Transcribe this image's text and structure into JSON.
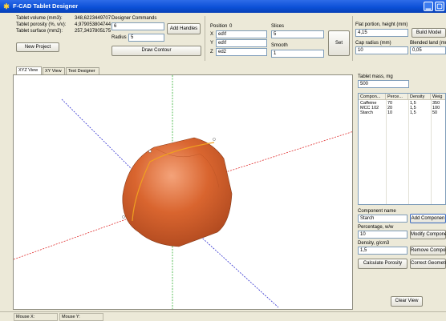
{
  "window": {
    "title": "F-CAD Tablet Designer",
    "icon": "app-logo-icon",
    "controls": [
      "minimize-icon",
      "maximize-icon"
    ]
  },
  "stats": {
    "volume_label": "Tablet volume (mm3):",
    "volume_value": "348,6223449707",
    "porosity_label": "Tablet porosity (%, v/v):",
    "porosity_value": "4,979053804744",
    "surface_label": "Tablet surface (mm2):",
    "surface_value": "257,3437805175"
  },
  "toolbar": {
    "new_project": "New Project",
    "designer_commands_label": "Designer Commands",
    "designer_commands_value": "6",
    "radius_label": "Radius",
    "radius_value": "5",
    "add_handles": "Add Handles",
    "draw_contour": "Draw Contour"
  },
  "position": {
    "label": "Position",
    "value": "0",
    "x_label": "X",
    "x_value": "ed\\f",
    "y_label": "Y",
    "y_value": "ed\\f",
    "z_label": "Z",
    "z_value": "ed2"
  },
  "slices": {
    "slices_label": "Slices",
    "slices_value": "5",
    "smooth_label": "Smooth",
    "smooth_value": "1",
    "set": "Set"
  },
  "model": {
    "flat_label": "Flat portion, height (mm)",
    "flat_value": "4,15",
    "build_model": "Build Model",
    "cap_radius_label": "Cap radius (mm)",
    "cap_radius_value": "10",
    "blended_land_label": "Blended land (mm)",
    "blended_land_value": "0,05"
  },
  "tabs": [
    {
      "label": "XYZ View"
    },
    {
      "label": "XY View"
    },
    {
      "label": "Text Designer"
    }
  ],
  "components": {
    "tablet_mass_label": "Tablet mass, mg",
    "tablet_mass_value": "500",
    "headers": [
      "Compon...",
      "Perce...",
      "Density",
      "Weig"
    ],
    "rows": [
      {
        "name": "Caffeine",
        "percent": "70",
        "density": "1,5",
        "weight": "350"
      },
      {
        "name": "MCC 102",
        "percent": "20",
        "density": "1,5",
        "weight": "100"
      },
      {
        "name": "Starch",
        "percent": "10",
        "density": "1,5",
        "weight": "50"
      }
    ],
    "name_label": "Component name",
    "name_value": "Starch",
    "add_component": "Add Componen",
    "percentage_label": "Percentage, w/w",
    "percentage_value": "10",
    "modify_component": "Modify Compone",
    "density_label": "Density, g/cm3",
    "density_value": "1,5",
    "remove_component": "Remove Compon",
    "calculate_porosity": "Calculate Porosity",
    "correct_geometry": "Correct Geometr",
    "clear_view": "Clear View"
  },
  "status": {
    "mouse_x": "Mouse X:",
    "mouse_y": "Mouse Y:"
  },
  "colors": {
    "titlebar": "#0a4fd6",
    "tablet_body": "#d2602e",
    "contour": "#f0a020",
    "axis_x": "#e03030",
    "axis_y": "#30b030",
    "axis_z": "#3030d0"
  }
}
